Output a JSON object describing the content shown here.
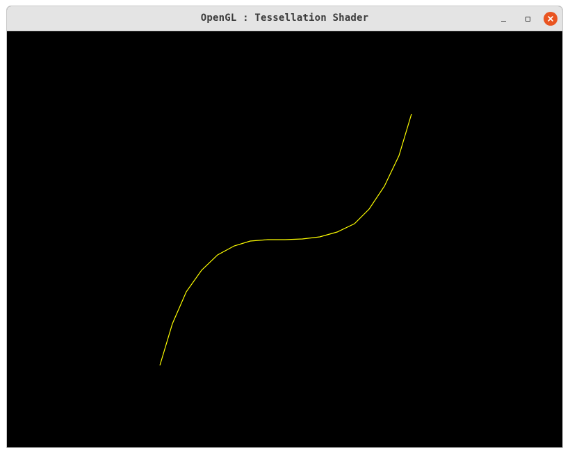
{
  "window": {
    "title": "OpenGL : Tessellation Shader"
  },
  "titlebar_buttons": [
    "minimize",
    "maximize",
    "close"
  ],
  "icons": {
    "minimize": "minimize-icon",
    "maximize": "maximize-icon",
    "close": "close-icon"
  },
  "colors": {
    "titlebar_bg": "#e4e4e4",
    "viewport_bg": "#000000",
    "curve": "#ffff00",
    "close_button": "#e95420"
  }
}
